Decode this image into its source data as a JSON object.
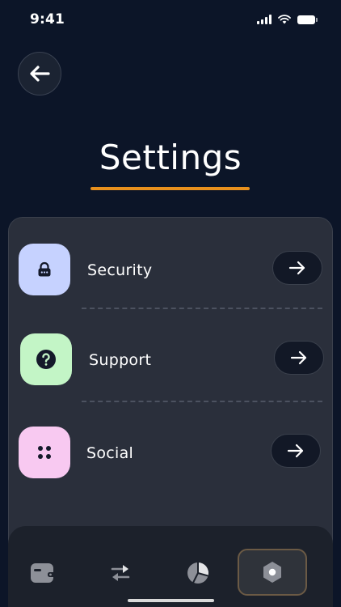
{
  "status_bar": {
    "time": "9:41",
    "icons": [
      "cellular-signal-icon",
      "wifi-icon",
      "battery-icon"
    ]
  },
  "header": {
    "back_icon": "arrow-left-icon",
    "title": "Settings",
    "underline_color": "#e8901d"
  },
  "settings": {
    "items": [
      {
        "label": "Security",
        "icon": "lock-icon",
        "tile_color": "#c6d2ff",
        "action_icon": "arrow-right-icon"
      },
      {
        "label": "Support",
        "icon": "question-circle-icon",
        "tile_color": "#c3f5c6",
        "action_icon": "arrow-right-icon"
      },
      {
        "label": "Social",
        "icon": "four-dots-icon",
        "tile_color": "#f8c9f1",
        "action_icon": "arrow-right-icon"
      }
    ]
  },
  "bottom_nav": {
    "items": [
      {
        "icon": "wallet-icon",
        "active": false
      },
      {
        "icon": "transfer-arrows-icon",
        "active": false
      },
      {
        "icon": "pie-chart-icon",
        "active": false
      },
      {
        "icon": "settings-hexagon-icon",
        "active": true
      }
    ]
  },
  "colors": {
    "background": "#0c1528",
    "card": "#2a2f3b",
    "nav": "#1c212b",
    "accent": "#e8901d"
  }
}
